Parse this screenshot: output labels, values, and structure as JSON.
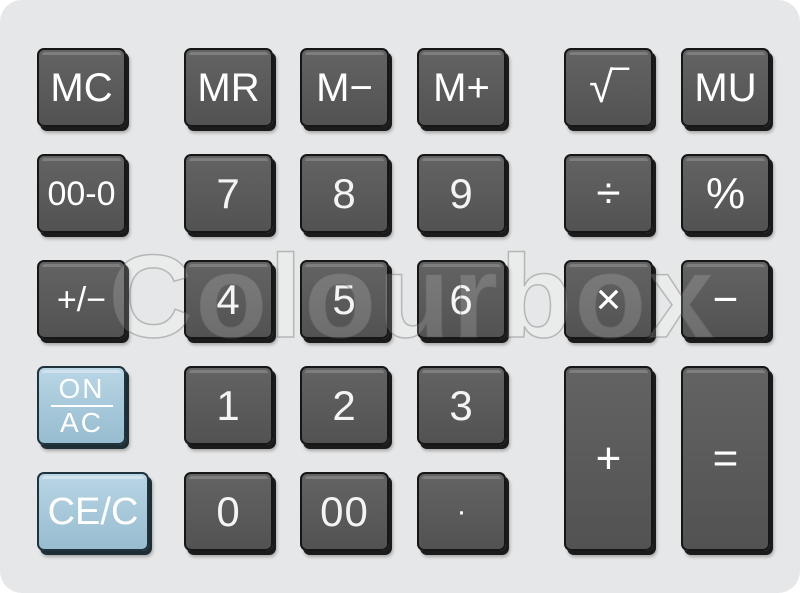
{
  "keys": {
    "mc": "MC",
    "mr": "MR",
    "m_minus": "M−",
    "m_plus": "M+",
    "sqrt": "√‾",
    "mu": "MU",
    "double_zero_zero": "00-0",
    "seven": "7",
    "eight": "8",
    "nine": "9",
    "divide": "÷",
    "percent": "%",
    "plus_minus": "+/−",
    "four": "4",
    "five": "5",
    "six": "6",
    "multiply": "×",
    "minus": "−",
    "on": "ON",
    "ac": "AC",
    "one": "1",
    "two": "2",
    "three": "3",
    "plus": "+",
    "equals": "=",
    "ce_c": "CE/C",
    "zero": "0",
    "double_zero": "00",
    "decimal": "·"
  },
  "watermark": "Colourbox",
  "colors": {
    "panel": "#e6e7e8",
    "key_dark": "#5e5e5e",
    "key_blue": "#a9c9da",
    "label": "#ffffff"
  }
}
